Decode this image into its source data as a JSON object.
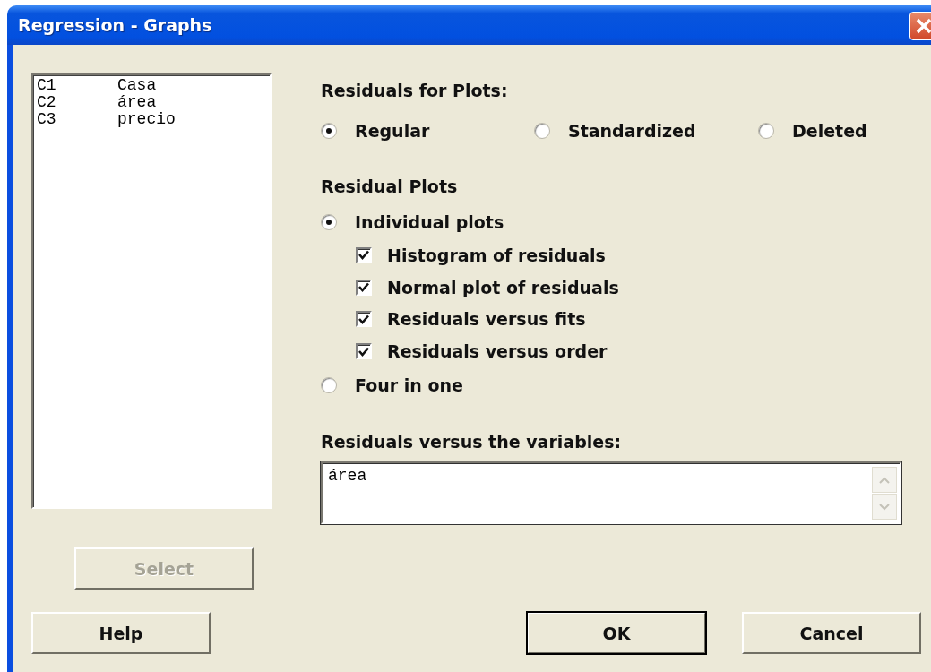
{
  "window": {
    "title": "Regression - Graphs"
  },
  "variables": [
    {
      "column": "C1",
      "name": "Casa"
    },
    {
      "column": "C2",
      "name": "área"
    },
    {
      "column": "C3",
      "name": "precio"
    }
  ],
  "residuals_for_plots": {
    "label": "Residuals for Plots:",
    "options": [
      {
        "label": "Regular",
        "selected": true
      },
      {
        "label": "Standardized",
        "selected": false
      },
      {
        "label": "Deleted",
        "selected": false
      }
    ]
  },
  "residual_plots": {
    "label": "Residual Plots",
    "options": [
      {
        "label": "Individual plots",
        "selected": true,
        "children": [
          {
            "label": "Histogram of residuals",
            "checked": true
          },
          {
            "label": "Normal plot of residuals",
            "checked": true
          },
          {
            "label": "Residuals versus fits",
            "checked": true
          },
          {
            "label": "Residuals versus order",
            "checked": true
          }
        ]
      },
      {
        "label": "Four in one",
        "selected": false
      }
    ]
  },
  "residuals_versus_variables": {
    "label": "Residuals versus the variables:",
    "value": "área"
  },
  "buttons": [
    {
      "label": "Select",
      "disabled": true,
      "default": false
    },
    {
      "label": "Help",
      "disabled": false,
      "default": false
    },
    {
      "label": "OK",
      "disabled": false,
      "default": true
    },
    {
      "label": "Cancel",
      "disabled": false,
      "default": false
    }
  ]
}
